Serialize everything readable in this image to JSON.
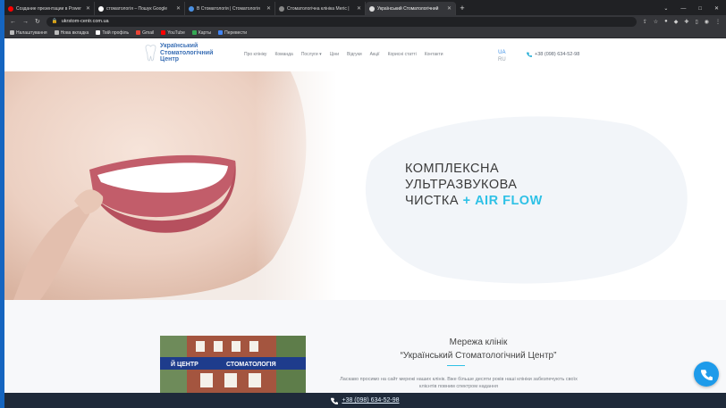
{
  "browser": {
    "tabs": [
      {
        "title": "Создание презентации в Power",
        "favicon": "youtube-icon",
        "color": "#ff0000"
      },
      {
        "title": "стоматологія – Пошук Google",
        "favicon": "google-icon",
        "color": "#ffffff"
      },
      {
        "title": "В Стоматологія | Стоматологія",
        "favicon": "tooth-icon",
        "color": "#4a90e2"
      },
      {
        "title": "Стоматологічна клініка Мегіс |",
        "favicon": "globe-icon",
        "color": "#888888"
      },
      {
        "title": "Український Стоматологічний",
        "favicon": "tooth-icon",
        "color": "#dddddd",
        "active": true
      }
    ],
    "url": "ukrstom-centr.com.ua",
    "bookmarks": [
      {
        "label": "Налаштування",
        "icon": "gear-icon",
        "color": "#bbbbbb"
      },
      {
        "label": "Нова вкладка",
        "icon": "globe-icon",
        "color": "#bbbbbb"
      },
      {
        "label": "Твій профіль",
        "icon": "github-icon",
        "color": "#ffffff"
      },
      {
        "label": "Gmail",
        "icon": "gmail-icon",
        "color": "#ea4335"
      },
      {
        "label": "YouTube",
        "icon": "youtube-icon",
        "color": "#ff0000"
      },
      {
        "label": "Карты",
        "icon": "maps-icon",
        "color": "#34a853"
      },
      {
        "label": "Перевести",
        "icon": "translate-icon",
        "color": "#4285f4"
      }
    ]
  },
  "site": {
    "logo_lines": [
      "Український",
      "Стоматологічний",
      "Центр"
    ],
    "nav": [
      "Про клініку",
      "Команда",
      "Послуги ▾",
      "Ціни",
      "Відгуки",
      "Акції",
      "Корисні статті",
      "Контакти"
    ],
    "lang_active": "UA",
    "lang_other": "RU",
    "phone": "+38 (098) 634-52-98"
  },
  "hero": {
    "line1": "КОМПЛЕКСНА",
    "line2": "УЛЬТРАЗВУКОВА",
    "line3": "ЧИСТКА",
    "accent": "+ AIR FLOW"
  },
  "about": {
    "title_line1": "Мережа клінік",
    "title_line2": "“Український Стоматологічний Центр”",
    "text": "Ласкаво просимо на сайт мережі наших клінік. Вже більше десяти років наші клініки забезпечують своїх клієнтів повним спектром надання",
    "building_sign_left": "Й ЦЕНТР",
    "building_sign_right": "СТОМАТОЛОГІЯ"
  },
  "bottom_phone": "+38 (098) 634-52-98",
  "colors": {
    "accent": "#2fc1e6",
    "brand_blue": "#3a6fb5",
    "fab": "#1e9bea",
    "bar": "#1f2a3a"
  }
}
